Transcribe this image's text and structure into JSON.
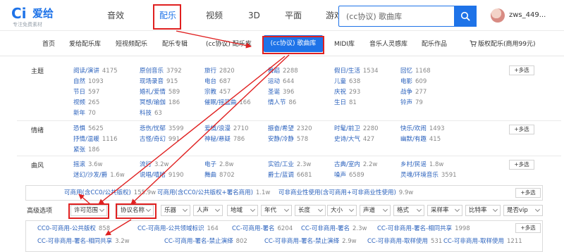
{
  "header": {
    "logo_mark": "Ci",
    "logo_name": "爱给",
    "logo_slogan": "专注免费素材",
    "nav": [
      "音效",
      "配乐",
      "视频",
      "3D",
      "平面",
      "游戏",
      "教程"
    ],
    "nav_active_index": 1,
    "search_placeholder": "(cc协议) 歌曲库",
    "search_icon": "search-icon",
    "username": "zws_449..."
  },
  "subnav": {
    "items": [
      "首页",
      "爱给配乐库",
      "短视频配乐",
      "配乐专辑",
      "(cc协议) 配乐库",
      "(cc协议) 歌曲库",
      "MIDI库",
      "音乐人灵感库",
      "配乐作品"
    ],
    "active_index": 5,
    "cart_label": "版权配乐(商用99元)",
    "cart_icon": "cart-icon"
  },
  "filter_groups": [
    {
      "label": "主题",
      "more": "+多选",
      "chips": [
        {
          "k": "阅读/演讲",
          "v": "4175"
        },
        {
          "k": "原创音乐",
          "v": "3792"
        },
        {
          "k": "旅行",
          "v": "2820"
        },
        {
          "k": "舞蹈",
          "v": "2288"
        },
        {
          "k": "假日/生活",
          "v": "1534"
        },
        {
          "k": "回忆",
          "v": "1168"
        },
        {
          "k": "自然",
          "v": "1093"
        },
        {
          "k": "现场录音",
          "v": "915"
        },
        {
          "k": "电台",
          "v": "687"
        },
        {
          "k": "运动",
          "v": "644"
        },
        {
          "k": "儿童",
          "v": "638"
        },
        {
          "k": "电影",
          "v": "609"
        },
        {
          "k": "节日",
          "v": "597"
        },
        {
          "k": "婚礼/爱情",
          "v": "589"
        },
        {
          "k": "宗教",
          "v": "457"
        },
        {
          "k": "圣诞",
          "v": "396"
        },
        {
          "k": "庆祝",
          "v": "293"
        },
        {
          "k": "战争",
          "v": "277"
        },
        {
          "k": "视频",
          "v": "265"
        },
        {
          "k": "冥想/瑜伽",
          "v": "186"
        },
        {
          "k": "催眠/摇篮曲",
          "v": "166"
        },
        {
          "k": "情人节",
          "v": "86"
        },
        {
          "k": "生日",
          "v": "81"
        },
        {
          "k": "铃声",
          "v": "79"
        },
        {
          "k": "新年",
          "v": "70"
        },
        {
          "k": "科技",
          "v": "63"
        }
      ]
    },
    {
      "label": "情绪",
      "more": "+多选",
      "chips": [
        {
          "k": "恐惧",
          "v": "5625"
        },
        {
          "k": "悲伤/忧郁",
          "v": "3599"
        },
        {
          "k": "爱情/浪漫",
          "v": "2710"
        },
        {
          "k": "振奋/希望",
          "v": "2320"
        },
        {
          "k": "时髦/前卫",
          "v": "2280"
        },
        {
          "k": "快乐/欢闹",
          "v": "1493"
        },
        {
          "k": "抒情/温暖",
          "v": "1116"
        },
        {
          "k": "古怪/奇幻",
          "v": "991"
        },
        {
          "k": "神秘/悬疑",
          "v": "786"
        },
        {
          "k": "安静/冷静",
          "v": "578"
        },
        {
          "k": "史诗/大气",
          "v": "427"
        },
        {
          "k": "幽默/有趣",
          "v": "415"
        },
        {
          "k": "紧张",
          "v": "186"
        }
      ]
    },
    {
      "label": "曲风",
      "more": "+多选",
      "chips": [
        {
          "k": "摇滚",
          "v": "3.6w"
        },
        {
          "k": "流行",
          "v": "3.2w"
        },
        {
          "k": "电子",
          "v": "2.8w"
        },
        {
          "k": "实验/工业",
          "v": "2.3w"
        },
        {
          "k": "古典/室内",
          "v": "2.2w"
        },
        {
          "k": "乡村/民谣",
          "v": "1.8w"
        },
        {
          "k": "迷幻/沙发/爵",
          "v": "1.6w"
        },
        {
          "k": "说唱/嘻哈",
          "v": "9190"
        },
        {
          "k": "舞曲",
          "v": "8702"
        },
        {
          "k": "爵士/蓝调",
          "v": "6681"
        },
        {
          "k": "噪声",
          "v": "6589"
        },
        {
          "k": "灵魂/环境音乐",
          "v": "3591"
        }
      ]
    }
  ],
  "license": {
    "more": "+多选",
    "chips": [
      {
        "k": "可商用(含CC0/公共版权)",
        "v": "155.9w"
      },
      {
        "k": "可商用(含CC0/公共版权+署名商用)",
        "v": "1.1w"
      },
      {
        "k": "可非商业性使用(含可商用+可非商业性使用)",
        "v": "9.9w"
      }
    ]
  },
  "advanced": {
    "label": "高级选项",
    "dropdowns": [
      "许可范围",
      "协议名称",
      "乐器",
      "人声",
      "地域",
      "年代",
      "长度",
      "大小",
      "声道",
      "格式",
      "采样率",
      "比特率",
      "是否vip"
    ]
  },
  "protocols": {
    "more": "+多选",
    "chips": [
      {
        "k": "CC0-可商用-公共版权",
        "v": "858"
      },
      {
        "k": "CC-可商用-公共领域标识",
        "v": "164"
      },
      {
        "k": "CC-可商用-署名",
        "v": "6204"
      },
      {
        "k": "CC-可非商用-署名",
        "v": "2.3w"
      },
      {
        "k": "CC-可非商用-署名-相同共享",
        "v": "1998"
      },
      {
        "k": "CC-可非商用-署名-相同共享",
        "v": "3.2w"
      },
      {
        "k": "CC-可商用-署名-禁止演绎",
        "v": "802"
      },
      {
        "k": "CC-可非商用-署名-禁止演绎",
        "v": "2.9w"
      },
      {
        "k": "CC-可非商用-取样使用",
        "v": "531"
      },
      {
        "k": "CC-可非商用-取样使用",
        "v": "1211"
      }
    ]
  },
  "accent": "#1e73e8",
  "annotation_color": "#e02020"
}
